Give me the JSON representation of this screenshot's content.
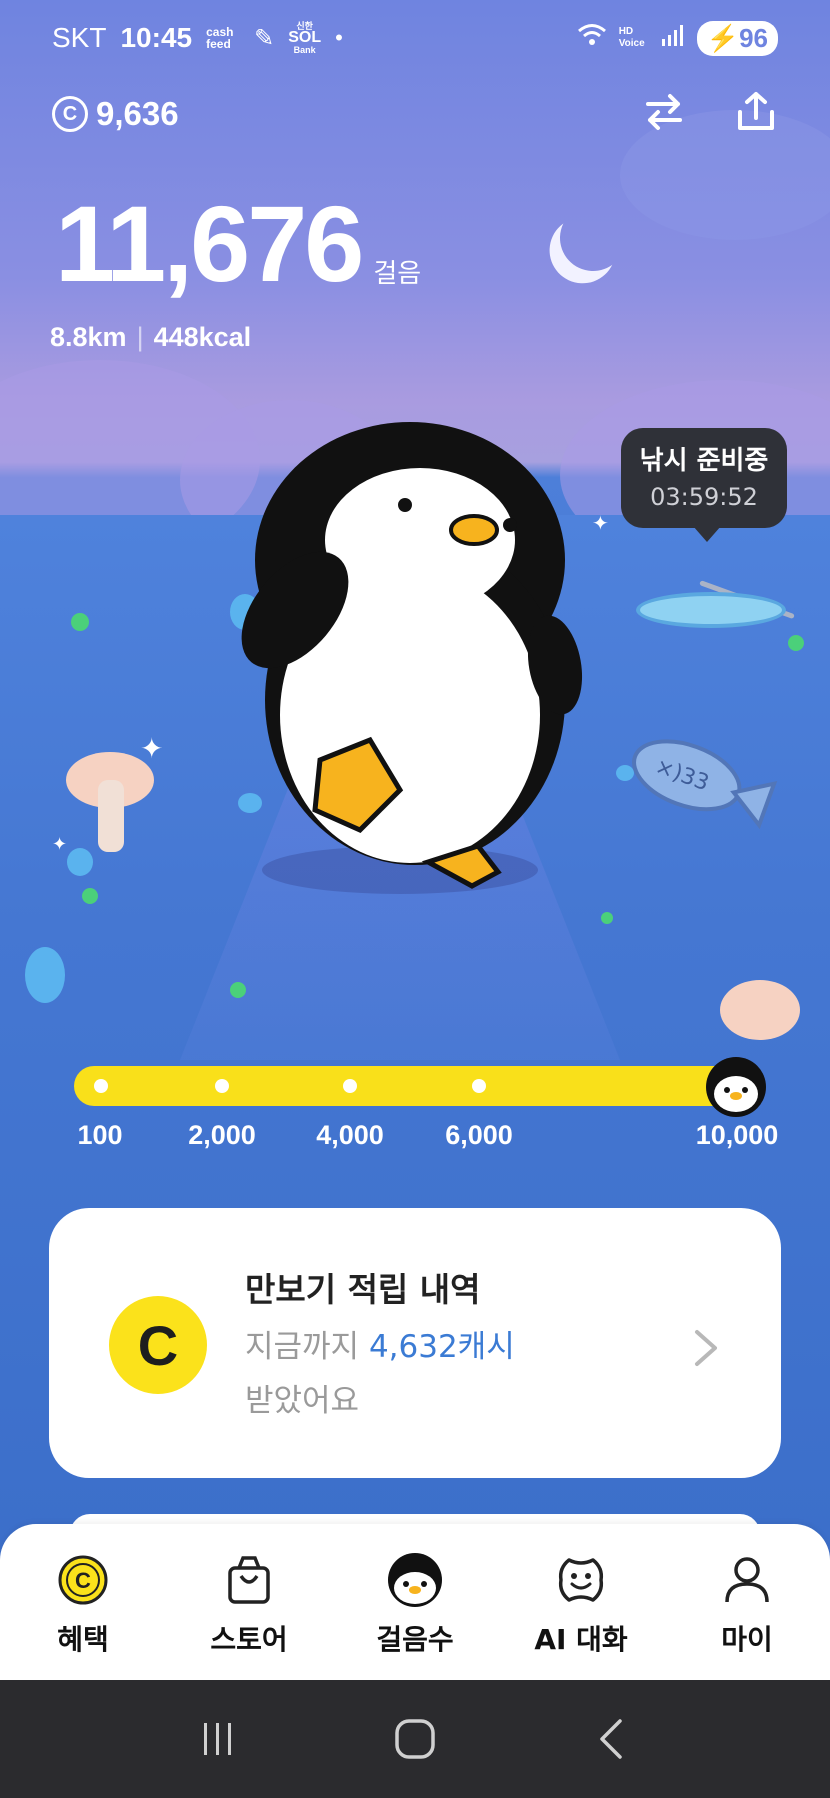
{
  "status_bar": {
    "carrier": "SKT",
    "time": "10:45",
    "app_cash": "cash feed",
    "app_bank_top": "신한",
    "app_bank_main": "SOL",
    "app_bank_bottom": "Bank",
    "hd_voice": "HD Voice",
    "battery": "96"
  },
  "header": {
    "coin_symbol": "C",
    "coins": "9,636"
  },
  "stats": {
    "steps": "11,676",
    "steps_unit": "걸음",
    "distance": "8.8km",
    "calories": "448kcal"
  },
  "fishing_tooltip": {
    "title": "낚시 준비중",
    "time": "03:59:52"
  },
  "progress": {
    "labels": [
      "100",
      "2,000",
      "4,000",
      "6,000",
      "10,000"
    ],
    "current_steps": 11676,
    "goal": 10000
  },
  "history_card": {
    "coin_symbol": "C",
    "title": "만보기 적립 내역",
    "desc_prefix": "지금까지 ",
    "desc_amount": "4,632캐시",
    "desc_suffix": "받았어요"
  },
  "tabbar": {
    "tabs": [
      {
        "label": "혜택",
        "icon": "coin-icon"
      },
      {
        "label": "스토어",
        "icon": "shopping-bag-icon"
      },
      {
        "label": "걸음수",
        "icon": "penguin-icon"
      },
      {
        "label": "AI 대화",
        "icon": "smile-chat-icon"
      },
      {
        "label": "마이",
        "icon": "person-icon"
      }
    ]
  },
  "colors": {
    "accent_yellow": "#f9e01a",
    "sky_top": "#6f84e0",
    "water": "#4577d2",
    "highlight_blue": "#3b7bd4"
  }
}
